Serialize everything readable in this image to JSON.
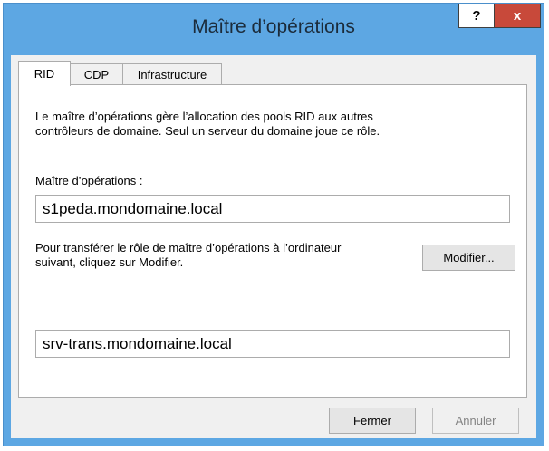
{
  "window": {
    "title": "Maître d’opérations",
    "help_label": "?",
    "close_label": "x"
  },
  "tabs": [
    {
      "label": "RID",
      "active": true
    },
    {
      "label": "CDP",
      "active": false
    },
    {
      "label": "Infrastructure",
      "active": false
    }
  ],
  "panel": {
    "description_line1": "Le maître d’opérations gère l’allocation des pools RID aux autres",
    "description_line2": "contrôleurs de domaine. Seul un serveur du domaine joue ce rôle.",
    "master_label": "Maître d’opérations :",
    "master_value": "s1peda.mondomaine.local",
    "transfer_line1": "Pour transférer le rôle de maître d’opérations à l’ordinateur",
    "transfer_line2": "suivant, cliquez sur Modifier.",
    "modify_label": "Modifier...",
    "target_value": "srv-trans.mondomaine.local"
  },
  "footer": {
    "close_label": "Fermer",
    "cancel_label": "Annuler"
  }
}
